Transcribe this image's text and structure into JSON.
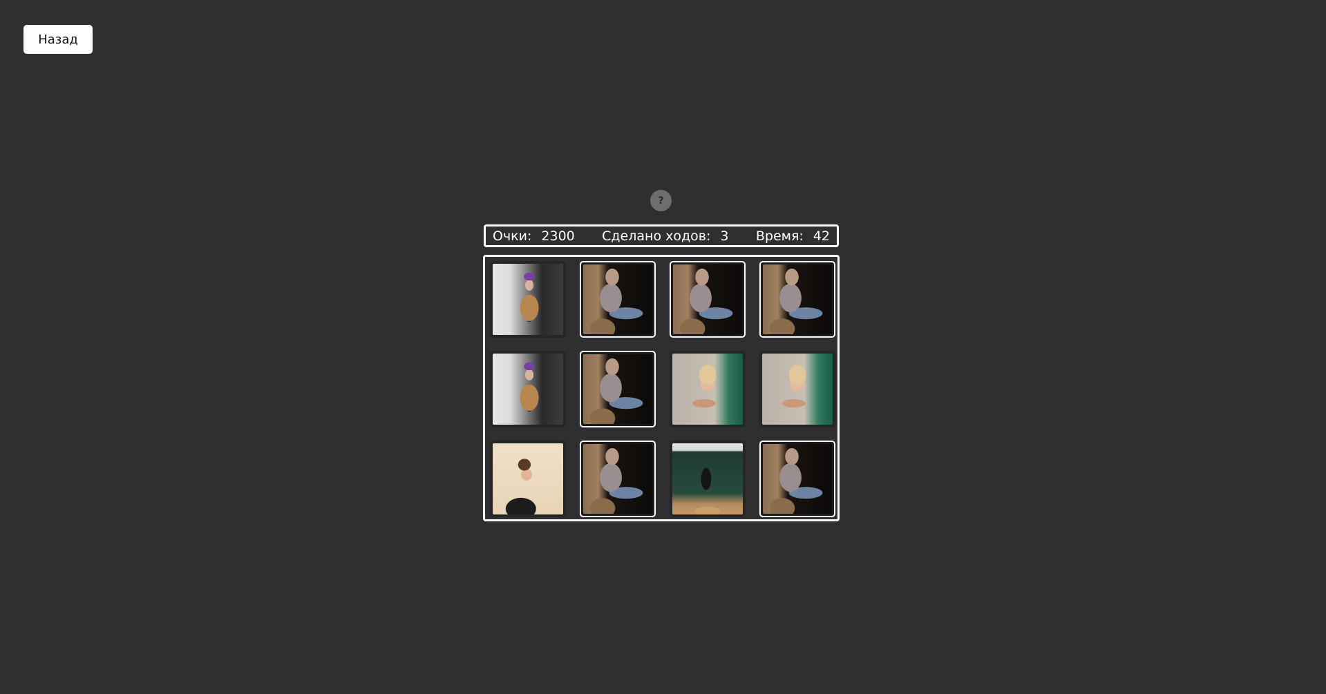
{
  "back_button": {
    "label": "Назад"
  },
  "help_button": {
    "label": "?"
  },
  "stats": {
    "score_label": "Очки:",
    "score_value": "2300",
    "moves_label": "Сделано ходов:",
    "moves_value": "3",
    "time_label": "Время:",
    "time_value": "42"
  },
  "board": {
    "rows": 3,
    "cols": 4,
    "cards": [
      {
        "state": "open",
        "image": "photo-person-purple-beanie"
      },
      {
        "state": "closed",
        "image": "card-back-man-on-rock"
      },
      {
        "state": "closed",
        "image": "card-back-man-on-rock"
      },
      {
        "state": "closed",
        "image": "card-back-man-on-rock"
      },
      {
        "state": "open",
        "image": "photo-person-purple-beanie"
      },
      {
        "state": "closed",
        "image": "card-back-man-on-rock"
      },
      {
        "state": "open",
        "image": "photo-blonde-girl-eating"
      },
      {
        "state": "open",
        "image": "photo-blonde-girl-eating"
      },
      {
        "state": "open",
        "image": "photo-young-man-with-phone"
      },
      {
        "state": "closed",
        "image": "card-back-man-on-rock"
      },
      {
        "state": "open",
        "image": "photo-woman-at-blackboard"
      },
      {
        "state": "closed",
        "image": "card-back-man-on-rock"
      }
    ]
  }
}
